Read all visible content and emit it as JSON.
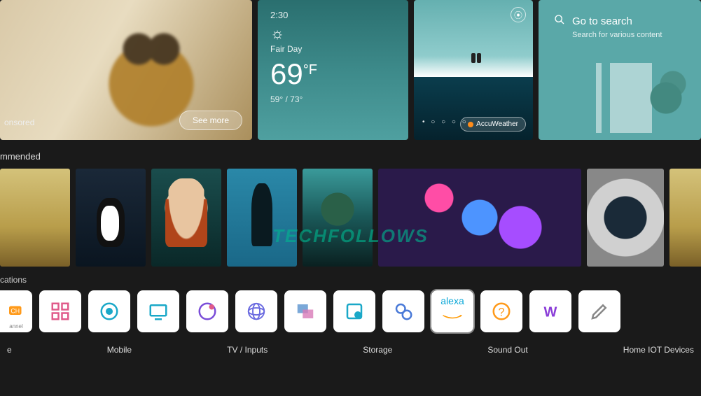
{
  "hero": {
    "sponsored_label": "onsored",
    "see_more_label": "See more",
    "weather": {
      "time": "2:30",
      "desc": "Fair Day",
      "temp": "69",
      "unit": "°F",
      "hilo": "59° / 73°"
    },
    "landscape": {
      "provider_label": "AccuWeather",
      "dots": "• ○ ○ ○ ○"
    },
    "search": {
      "title": "Go to search",
      "subtitle": "Search for various content"
    }
  },
  "recommended_label": "mmended",
  "watermark": "TECHFOLLOWS",
  "apps_label": "cations",
  "apps": [
    {
      "name": "channel",
      "label": "annel"
    },
    {
      "name": "dashboard",
      "label": ""
    },
    {
      "name": "home-hub",
      "label": ""
    },
    {
      "name": "tv",
      "label": ""
    },
    {
      "name": "notifications",
      "label": ""
    },
    {
      "name": "browser",
      "label": ""
    },
    {
      "name": "media",
      "label": ""
    },
    {
      "name": "storage",
      "label": ""
    },
    {
      "name": "sound",
      "label": ""
    },
    {
      "name": "alexa",
      "label": "alexa"
    },
    {
      "name": "help",
      "label": ""
    },
    {
      "name": "w-app",
      "label": ""
    },
    {
      "name": "edit",
      "label": ""
    }
  ],
  "bottom_menu": {
    "item1": "e",
    "item2": "Mobile",
    "item3": "TV / Inputs",
    "item4": "Storage",
    "item5": "Sound Out",
    "item6": "Home IOT Devices"
  }
}
